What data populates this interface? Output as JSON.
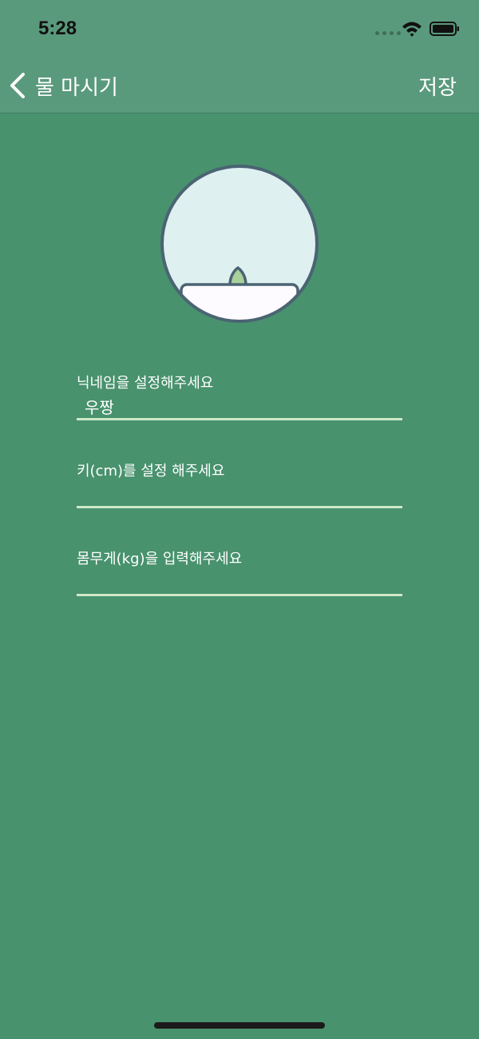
{
  "status_bar": {
    "time": "5:28"
  },
  "nav": {
    "back_label": "물 마시기",
    "save_label": "저장"
  },
  "avatar": {
    "icon": "plant-sprout-in-pot-icon"
  },
  "form": {
    "nickname": {
      "label": "닉네임을 설정해주세요",
      "value": "우짱"
    },
    "height": {
      "label": "키(cm)를 설정 해주세요",
      "value": ""
    },
    "weight": {
      "label": "몸무게(kg)을 입력해주세요",
      "value": ""
    }
  },
  "colors": {
    "background": "#48926d",
    "bar": "#5a9a7c",
    "underline": "#cfe8c8",
    "avatar_fill": "#dff0f1",
    "avatar_stroke": "#4a6472",
    "leaf": "#a8d09a"
  }
}
